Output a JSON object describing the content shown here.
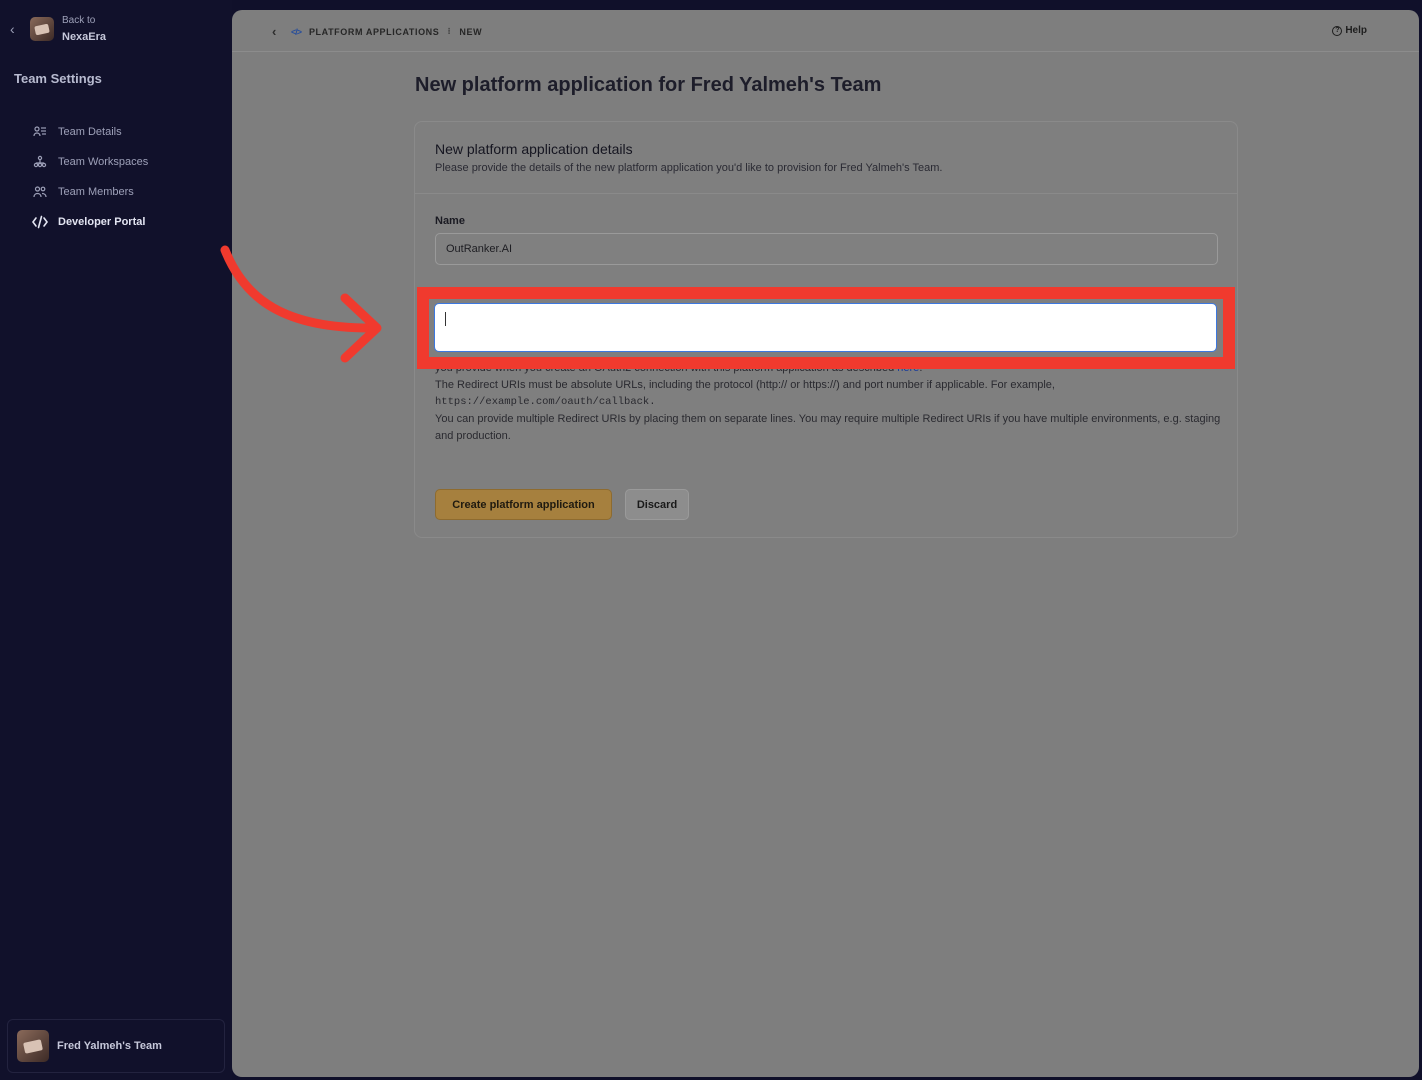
{
  "sidebar": {
    "back_small": "Back to",
    "back_name": "NexaEra",
    "title": "Team Settings",
    "items": [
      {
        "label": "Team Details",
        "icon": "team-details-icon"
      },
      {
        "label": "Team Workspaces",
        "icon": "workspaces-icon"
      },
      {
        "label": "Team Members",
        "icon": "members-icon"
      },
      {
        "label": "Developer Portal",
        "icon": "code-icon",
        "active": true
      }
    ],
    "team_name": "Fred Yalmeh's Team"
  },
  "topbar": {
    "crumb_section": "PLATFORM APPLICATIONS",
    "crumb_current": "NEW",
    "help": "Help"
  },
  "page": {
    "title": "New platform application for Fred Yalmeh's Team"
  },
  "card": {
    "title": "New platform application details",
    "subtitle": "Please provide the details of the new platform application you'd like to provision for Fred Yalmeh's Team.",
    "name_label": "Name",
    "name_value": "OutRanker.AI",
    "help_line2a": "you provide when you create an OAuth2 connection with this platform application as described ",
    "help_link": "here",
    "help_line2b": ".",
    "help_line3": "The Redirect URIs must be absolute URLs, including the protocol (http:// or https://) and port number if applicable. For example,",
    "help_example": "https://example.com/oauth/callback",
    "help_line4": "You can provide multiple Redirect URIs by placing them on separate lines. You may require multiple Redirect URIs if you have multiple environments, e.g. staging and production.",
    "create_label": "Create platform application",
    "discard_label": "Discard"
  },
  "colors": {
    "highlight": "#f03a2e",
    "accent": "#a6803e",
    "sidebar_bg": "#11112b"
  }
}
